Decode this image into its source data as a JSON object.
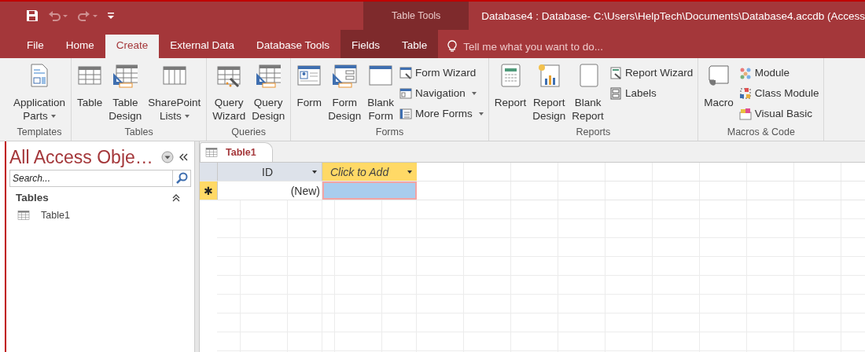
{
  "window": {
    "title": "Database4 : Database- C:\\Users\\HelpTech\\Documents\\Database4.accdb (Access",
    "context_label": "Table Tools"
  },
  "quick_access": [
    {
      "kind": "save",
      "disabled": false
    },
    {
      "kind": "undo",
      "disabled": true
    },
    {
      "kind": "redo",
      "disabled": true
    },
    {
      "kind": "customize",
      "disabled": false
    }
  ],
  "tabs": [
    {
      "label": "File",
      "selected": false,
      "contextual": false
    },
    {
      "label": "Home",
      "selected": false,
      "contextual": false
    },
    {
      "label": "Create",
      "selected": true,
      "contextual": false
    },
    {
      "label": "External Data",
      "selected": false,
      "contextual": false
    },
    {
      "label": "Database Tools",
      "selected": false,
      "contextual": false
    },
    {
      "label": "Fields",
      "selected": false,
      "contextual": true
    },
    {
      "label": "Table",
      "selected": false,
      "contextual": true
    }
  ],
  "tell_me": {
    "placeholder": "Tell me what you want to do..."
  },
  "ribbon": {
    "groups": [
      {
        "name": "Templates",
        "large": [
          {
            "lines": [
              "Application",
              "Parts"
            ],
            "dropdown": true
          }
        ]
      },
      {
        "name": "Tables",
        "large": [
          {
            "lines": [
              "Table"
            ],
            "dropdown": false
          },
          {
            "lines": [
              "Table",
              "Design"
            ],
            "dropdown": false
          },
          {
            "lines": [
              "SharePoint",
              "Lists"
            ],
            "dropdown": true
          }
        ]
      },
      {
        "name": "Queries",
        "large": [
          {
            "lines": [
              "Query",
              "Wizard"
            ],
            "dropdown": false
          },
          {
            "lines": [
              "Query",
              "Design"
            ],
            "dropdown": false
          }
        ]
      },
      {
        "name": "Forms",
        "large": [
          {
            "lines": [
              "Form"
            ],
            "dropdown": false
          },
          {
            "lines": [
              "Form",
              "Design"
            ],
            "dropdown": false
          },
          {
            "lines": [
              "Blank",
              "Form"
            ],
            "dropdown": false
          }
        ],
        "small": [
          {
            "label": "Form Wizard",
            "dropdown": false
          },
          {
            "label": "Navigation",
            "dropdown": true
          },
          {
            "label": "More Forms",
            "dropdown": true
          }
        ]
      },
      {
        "name": "Reports",
        "large": [
          {
            "lines": [
              "Report"
            ],
            "dropdown": false
          },
          {
            "lines": [
              "Report",
              "Design"
            ],
            "dropdown": false
          },
          {
            "lines": [
              "Blank",
              "Report"
            ],
            "dropdown": false
          }
        ],
        "small": [
          {
            "label": "Report Wizard",
            "dropdown": false
          },
          {
            "label": "Labels",
            "dropdown": false
          }
        ]
      },
      {
        "name": "Macros & Code",
        "large": [
          {
            "lines": [
              "Macro"
            ],
            "dropdown": false
          }
        ],
        "small": [
          {
            "label": "Module",
            "dropdown": false
          },
          {
            "label": "Class Module",
            "dropdown": false
          },
          {
            "label": "Visual Basic",
            "dropdown": false
          }
        ]
      }
    ]
  },
  "navigation_pane": {
    "title": "All Access Obje…",
    "search": {
      "placeholder": "Search..."
    },
    "sections": [
      {
        "label": "Tables",
        "expanded": true,
        "items": [
          {
            "label": "Table1",
            "selected": false
          }
        ]
      }
    ]
  },
  "document_tabs": [
    {
      "label": "Table1",
      "selected": true
    }
  ],
  "datasheet": {
    "columns": [
      {
        "label": "ID",
        "kind": "field"
      },
      {
        "label": "Click to Add",
        "kind": "add"
      }
    ],
    "rows": [
      {
        "marker": "✱",
        "cells": [
          {
            "text": "(New)",
            "selected": false
          },
          {
            "selected": true
          }
        ]
      }
    ]
  }
}
